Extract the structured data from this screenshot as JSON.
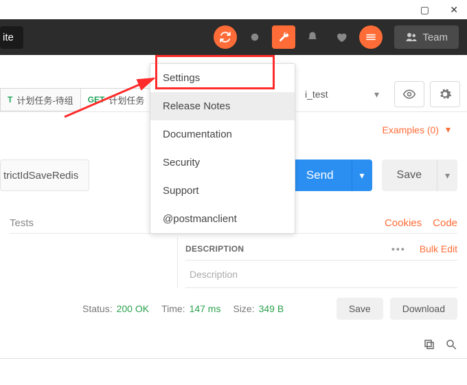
{
  "window": {
    "maximize": "▢",
    "close": "✕"
  },
  "topbar": {
    "invite": "ite",
    "team": "Team"
  },
  "tabs": [
    {
      "method": "T",
      "label": "计划任务-待组"
    },
    {
      "method": "GET",
      "label": "计划任务"
    }
  ],
  "env": {
    "selected": "i_test"
  },
  "examples": {
    "label": "Examples (0)"
  },
  "request": {
    "url_fragment": "trictIdSaveRedis",
    "send": "Send",
    "save": "Save"
  },
  "subtab": {
    "tests": "Tests",
    "cookies": "Cookies",
    "code": "Code"
  },
  "table": {
    "desc_header": "DESCRIPTION",
    "bulk_edit": "Bulk Edit",
    "desc_placeholder": "Description"
  },
  "response": {
    "status_lbl": "Status:",
    "status_val": "200 OK",
    "time_lbl": "Time:",
    "time_val": "147 ms",
    "size_lbl": "Size:",
    "size_val": "349 B",
    "save": "Save",
    "download": "Download"
  },
  "menu": {
    "settings": "Settings",
    "release_notes": "Release Notes",
    "documentation": "Documentation",
    "security": "Security",
    "support": "Support",
    "twitter": "@postmanclient"
  }
}
